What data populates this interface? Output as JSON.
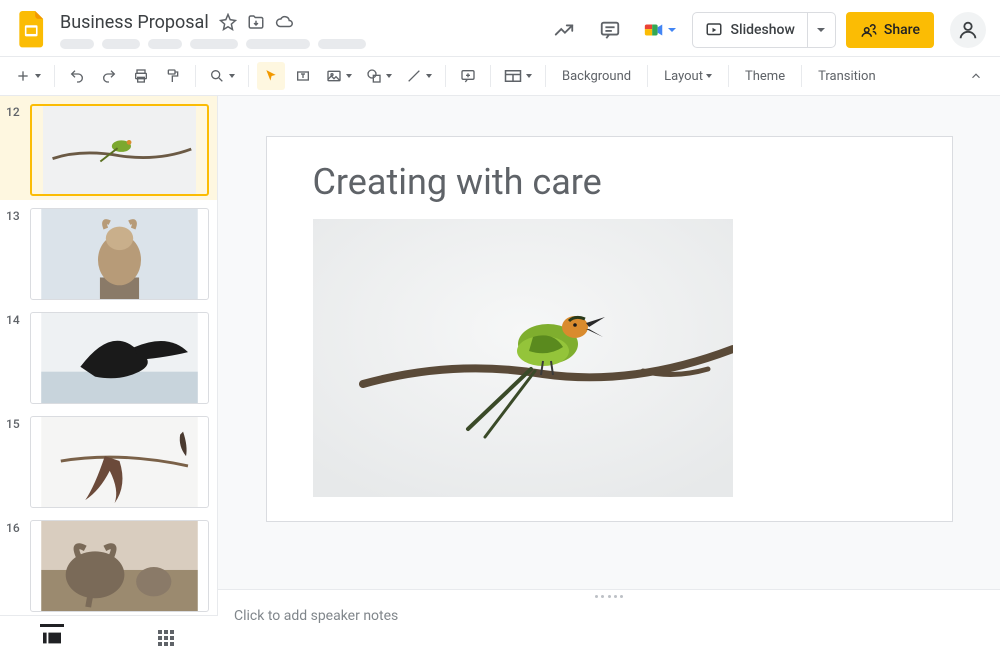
{
  "header": {
    "doc_title": "Business Proposal",
    "star_icon": "star-icon",
    "move_icon": "move-icon",
    "cloud_icon": "cloud-status-icon",
    "actions": {
      "activity_icon": "activity-icon",
      "comments_icon": "comments-icon",
      "meet_icon": "meet-icon",
      "slideshow_label": "Slideshow",
      "share_label": "Share"
    }
  },
  "toolbar": {
    "background_label": "Background",
    "layout_label": "Layout",
    "theme_label": "Theme",
    "transition_label": "Transition"
  },
  "filmstrip": {
    "slides": [
      {
        "number": "12",
        "selected": true,
        "alt": "Green bird on branch"
      },
      {
        "number": "13",
        "selected": false,
        "alt": "Squirrel"
      },
      {
        "number": "14",
        "selected": false,
        "alt": "Flying black bird"
      },
      {
        "number": "15",
        "selected": false,
        "alt": "Bat on branch"
      },
      {
        "number": "16",
        "selected": false,
        "alt": "Elephants"
      }
    ]
  },
  "canvas": {
    "slide_title": "Creating with care",
    "image_alt": "Green bee-eater bird perched on a bare branch"
  },
  "notes": {
    "placeholder": "Click to add speaker notes"
  }
}
